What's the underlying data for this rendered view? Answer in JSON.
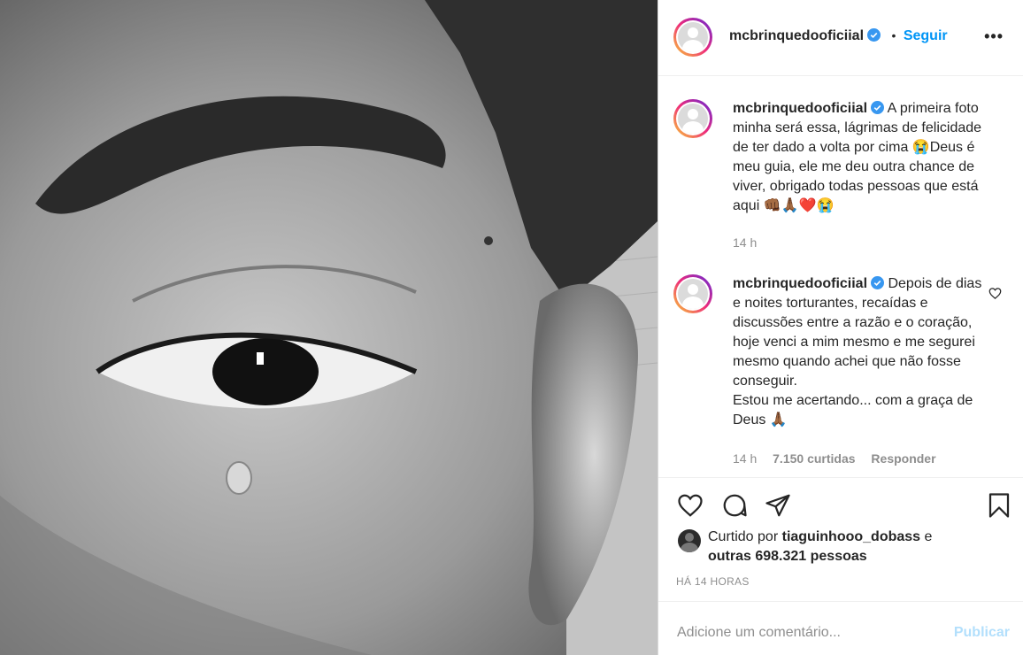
{
  "post": {
    "username": "mcbrinquedooficiial",
    "separator": "•",
    "follow_label": "Seguir",
    "more_icon": "more-horizontal-icon",
    "verified_icon": "verified-badge-icon"
  },
  "comments": [
    {
      "username": "mcbrinquedooficiial",
      "text": "A primeira foto minha será essa, lágrimas de felicidade de ter dado a volta por cima 😭Deus é meu guia, ele me deu outra chance de viver, obrigado todas pessoas que está aqui 👊🏾🙏🏾❤️😭",
      "time": "14 h"
    },
    {
      "username": "mcbrinquedooficiial",
      "text_lines": [
        "Depois de dias e noites torturantes, recaídas e discussões entre a razão e o coração, hoje venci a mim mesmo e me segurei mesmo quando achei que não fosse conseguir.",
        "Estou me acertando... com a graça de Deus 🙏🏾"
      ],
      "time": "14 h",
      "likes": "7.150 curtidas",
      "reply_label": "Responder"
    }
  ],
  "actions": {
    "like_icon": "heart-icon",
    "comment_icon": "comment-icon",
    "share_icon": "paper-plane-icon",
    "save_icon": "bookmark-icon"
  },
  "likes": {
    "prefix": "Curtido por",
    "liker": "tiaguinhooo_dobass",
    "conjunction": "e",
    "others": "outras 698.321 pessoas"
  },
  "timestamp": "HÁ 14 HORAS",
  "add_comment": {
    "placeholder": "Adicione um comentário...",
    "publish_label": "Publicar"
  },
  "colors": {
    "accent": "#0095f6",
    "publish_disabled": "#b2dffc",
    "secondary_text": "#8e8e8e"
  }
}
